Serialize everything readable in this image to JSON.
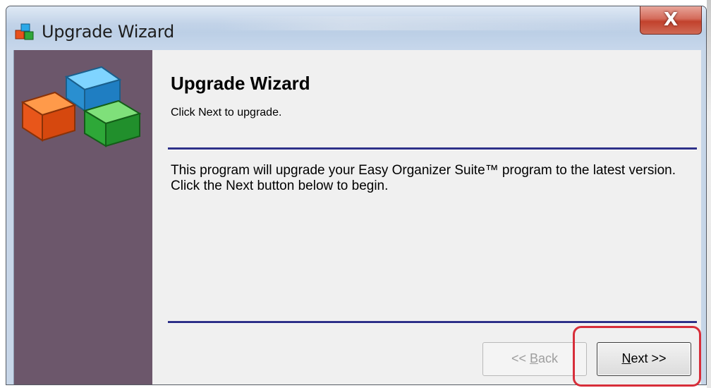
{
  "window": {
    "title": "Upgrade Wizard",
    "close_glyph": "X",
    "app_icon": "blocks-icon"
  },
  "wizard": {
    "heading": "Upgrade Wizard",
    "subheading": "Click Next to upgrade.",
    "body": "This program will upgrade your Easy Organizer Suite™ program to the latest version.  Click the Next button below to begin."
  },
  "buttons": {
    "back": {
      "prefix": "<< ",
      "mnemonic": "B",
      "rest": "ack",
      "enabled": false
    },
    "next": {
      "mnemonic": "N",
      "rest": "ext >>",
      "enabled": true
    }
  },
  "colors": {
    "side_panel": "#6c576b",
    "rule": "#2e3189",
    "highlight": "#d72e3a"
  }
}
